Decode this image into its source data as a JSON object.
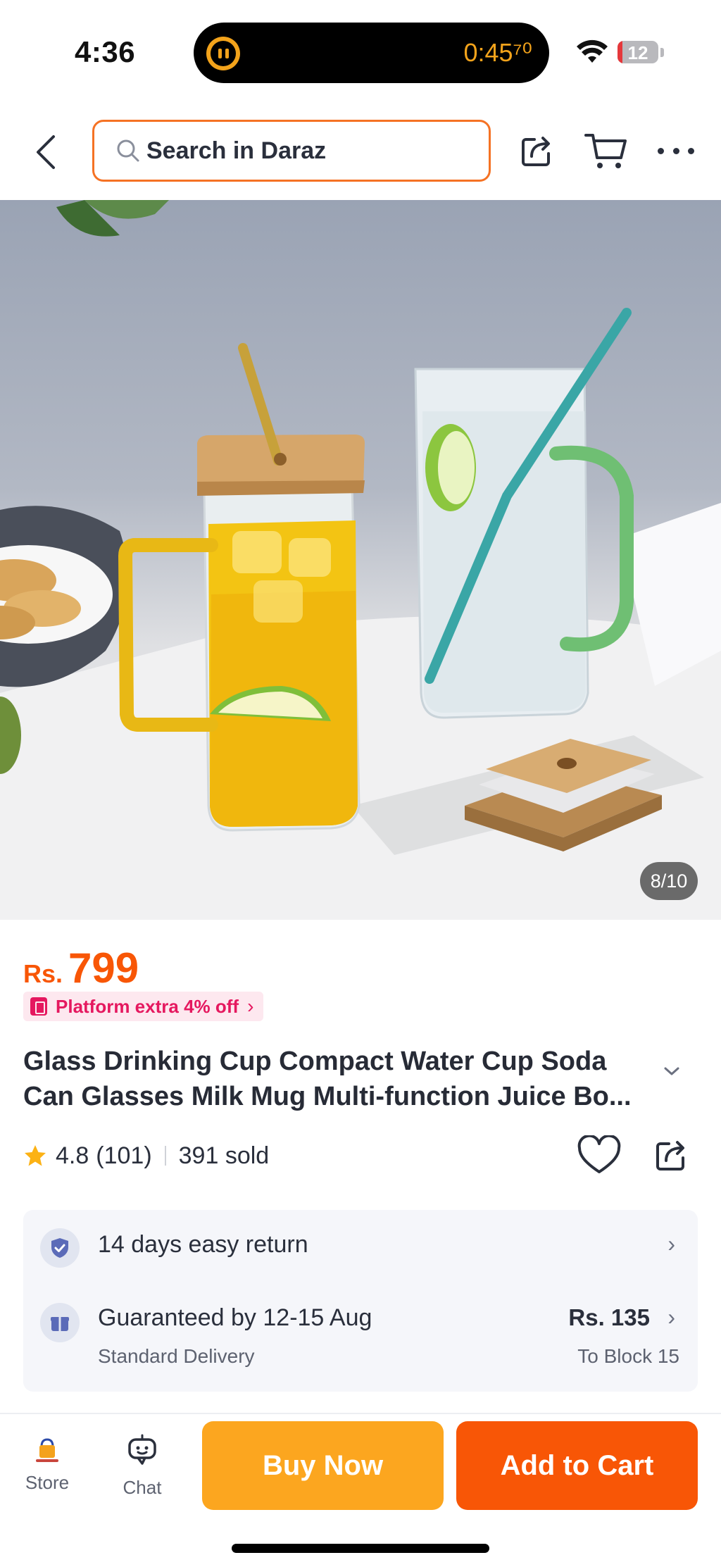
{
  "status_bar": {
    "time": "4:36",
    "stopwatch": "0:45⁷⁰",
    "battery_level": "12",
    "battery_fraction": 0.12
  },
  "nav": {
    "search_placeholder": "Search in Daraz",
    "accent_color": "#f57224"
  },
  "gallery": {
    "counter": "8/10"
  },
  "product": {
    "currency": "Rs.",
    "price": "799",
    "promo": "Platform extra 4% off",
    "title": "Glass Drinking Cup Compact Water Cup Soda Can Glasses Milk Mug Multi-function Juice Bo...",
    "rating": "4.8",
    "reviews": "(101)",
    "sold": "391 sold"
  },
  "services": {
    "return": "14 days easy return",
    "delivery_title": "Guaranteed by 12-15 Aug",
    "delivery_type": "Standard Delivery",
    "delivery_price": "Rs. 135",
    "delivery_dest": "To Block 15"
  },
  "bottom_bar": {
    "store_label": "Store",
    "chat_label": "Chat",
    "buy_now": "Buy Now",
    "add_to_cart": "Add to Cart",
    "buy_color": "#fca61f",
    "cart_color": "#f85606"
  },
  "icons": [
    "back-icon",
    "search-icon",
    "share-icon",
    "cart-icon",
    "more-icon",
    "star-icon",
    "heart-icon",
    "shield-icon",
    "gift-icon",
    "chat-icon",
    "store-logo"
  ]
}
